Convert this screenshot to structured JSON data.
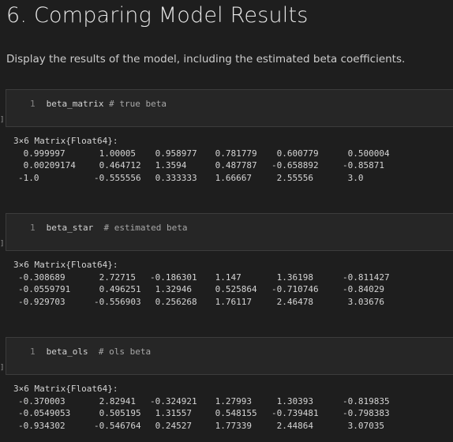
{
  "heading": "6. Comparing Model Results",
  "description": "Display the results of the model, including the estimated beta coefficients.",
  "cells": [
    {
      "line_number": "1",
      "code": "beta_matrix",
      "comment": "# true beta",
      "output_header": "3×6 Matrix{Float64}:",
      "rows": [
        [
          "0.999997",
          "1.00005",
          "0.958977",
          "0.781779",
          "0.600779",
          "0.500004"
        ],
        [
          "0.00209174",
          "0.464712",
          "1.3594",
          "0.487787",
          "-0.658892",
          "-0.85871"
        ],
        [
          "-1.0",
          "-0.555556",
          "0.333333",
          "1.66667",
          "2.55556",
          "3.0"
        ]
      ]
    },
    {
      "line_number": "1",
      "code": "beta_star",
      "comment": "# estimated beta",
      "output_header": "3×6 Matrix{Float64}:",
      "rows": [
        [
          "-0.308689",
          "2.72715",
          "-0.186301",
          "1.147",
          "1.36198",
          "-0.811427"
        ],
        [
          "-0.0559791",
          "0.496251",
          "1.32946",
          "0.525864",
          "-0.710746",
          "-0.84029"
        ],
        [
          "-0.929703",
          "-0.556903",
          "0.256268",
          "1.76117",
          "2.46478",
          "3.03676"
        ]
      ]
    },
    {
      "line_number": "1",
      "code": "beta_ols",
      "comment": "# ols beta",
      "output_header": "3×6 Matrix{Float64}:",
      "rows": [
        [
          "-0.370003",
          "2.82941",
          "-0.324921",
          "1.27993",
          "1.30393",
          "-0.819835"
        ],
        [
          "-0.0549053",
          "0.505195",
          "1.31557",
          "0.548155",
          "-0.739481",
          "-0.798383"
        ],
        [
          "-0.934302",
          "-0.546764",
          "0.24527",
          "1.77339",
          "2.44864",
          "3.07035"
        ]
      ]
    }
  ],
  "cell_marker": "]"
}
